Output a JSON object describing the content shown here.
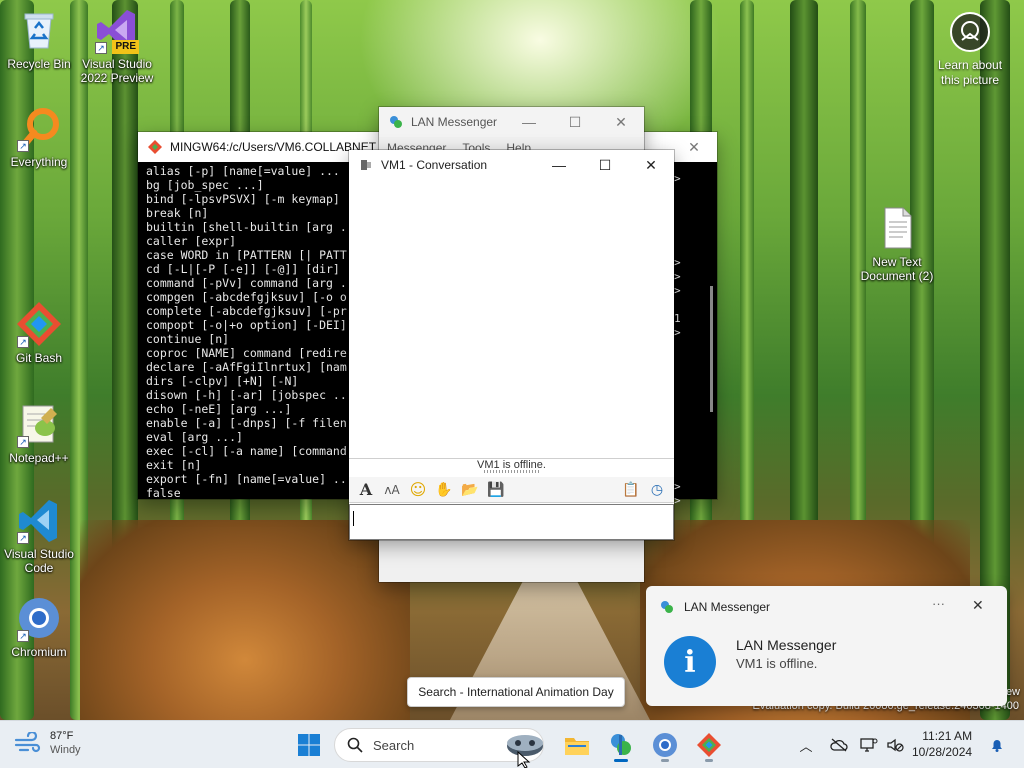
{
  "desktop": {
    "icons": [
      {
        "label": "Recycle Bin"
      },
      {
        "label": "Visual Studio 2022 Preview",
        "badge": "PRE"
      },
      {
        "label": "Everything"
      },
      {
        "label": "Git Bash"
      },
      {
        "label": "Notepad++"
      },
      {
        "label": "Visual Studio Code"
      },
      {
        "label": "Chromium"
      },
      {
        "label": "New Text Document (2)"
      }
    ],
    "learn_picture": "Learn about this picture",
    "watermark_line1": "ew",
    "watermark_line2": "Evaluation copy. Build 26080.ge_release.240308-1400"
  },
  "terminal": {
    "title": "MINGW64:/c/Users/VM6.COLLABNET",
    "lines": [
      "alias [-p] [name[=value] ...",
      "bg [job_spec ...]",
      "bind [-lpsvPSVX] [-m keymap]",
      "break [n]",
      "builtin [shell-builtin [arg .",
      "caller [expr]",
      "case WORD in [PATTERN [| PATT",
      "cd [-L|[-P [-e]] [-@]] [dir]",
      "command [-pVv] command [arg .",
      "compgen [-abcdefgjksuv] [-o o",
      "complete [-abcdefgjksuv] [-pr",
      "compopt [-o|+o option] [-DEI]",
      "continue [n]",
      "coproc [NAME] command [redire",
      "declare [-aAfFgiIlnrtux] [nam",
      "dirs [-clpv] [+N] [-N]",
      "disown [-h] [-ar] [jobspec ..",
      "echo [-neE] [arg ...]",
      "enable [-a] [-dnps] [-f filen",
      "eval [arg ...]",
      "exec [-cl] [-a name] [command",
      "exit [n]",
      "export [-fn] [name[=value] ..",
      "false"
    ],
    "right_fragments": [
      ">",
      "",
      "",
      "",
      "",
      "",
      ">",
      ">",
      ">",
      "",
      "1",
      ">",
      "",
      "",
      "",
      "",
      "",
      "",
      "",
      "",
      "",
      "",
      ">",
      ">"
    ]
  },
  "lan_main": {
    "title": "LAN Messenger",
    "menu": [
      "Messenger",
      "Tools",
      "Help"
    ]
  },
  "conversation": {
    "title": "VM1 - Conversation",
    "status": "VM1 is offline.",
    "input_value": ""
  },
  "tooltip": {
    "text": "Search - International Animation Day"
  },
  "toast": {
    "app": "LAN Messenger",
    "more": "···",
    "close": "✕",
    "title": "LAN Messenger",
    "message": "VM1 is offline."
  },
  "taskbar": {
    "weather_temp": "87°F",
    "weather_desc": "Windy",
    "search_placeholder": "Search",
    "time": "11:21 AM",
    "date": "10/28/2024"
  },
  "colors": {
    "accent": "#0067c0",
    "toast_info": "#1a7fd4"
  }
}
